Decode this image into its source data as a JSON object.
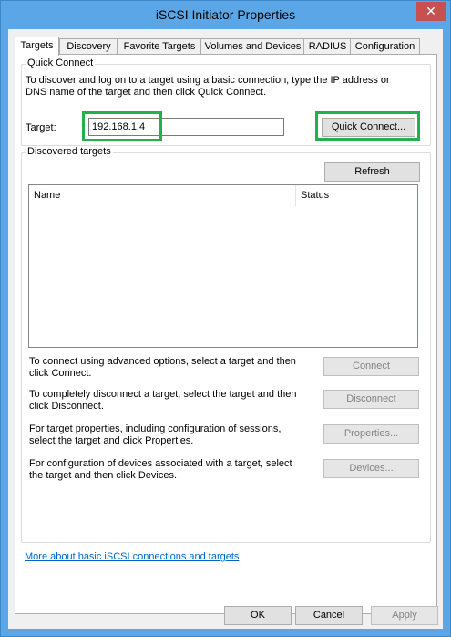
{
  "window": {
    "title": "iSCSI Initiator Properties",
    "close_glyph": "✕"
  },
  "tabs": [
    "Targets",
    "Discovery",
    "Favorite Targets",
    "Volumes and Devices",
    "RADIUS",
    "Configuration"
  ],
  "quick_connect": {
    "group_label": "Quick Connect",
    "description": "To discover and log on to a target using a basic connection, type the IP address or DNS name of the target and then click Quick Connect.",
    "target_label": "Target:",
    "target_value": "192.168.1.4",
    "button_label": "Quick Connect..."
  },
  "discovered": {
    "group_label": "Discovered targets",
    "refresh_label": "Refresh",
    "columns": [
      "Name",
      "Status"
    ],
    "rows": []
  },
  "actions": [
    {
      "text": "To connect using advanced options, select a target and then click Connect.",
      "button": "Connect"
    },
    {
      "text": "To completely disconnect a target, select the target and then click Disconnect.",
      "button": "Disconnect"
    },
    {
      "text": "For target properties, including configuration of sessions, select the target and click Properties.",
      "button": "Properties..."
    },
    {
      "text": "For configuration of devices associated with a target, select the target and then click Devices.",
      "button": "Devices..."
    }
  ],
  "link": "More about basic iSCSI connections and targets",
  "footer": {
    "ok": "OK",
    "cancel": "Cancel",
    "apply": "Apply"
  },
  "colors": {
    "titlebar": "#5aa6e6",
    "close": "#c75050",
    "highlight": "#22b14c",
    "link": "#0066cc"
  }
}
